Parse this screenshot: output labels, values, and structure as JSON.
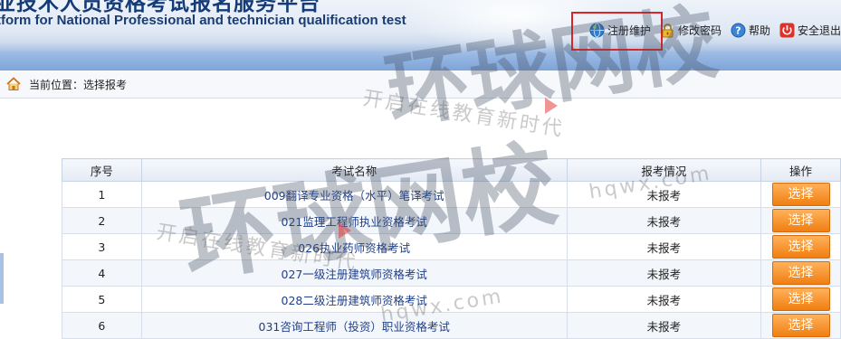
{
  "header": {
    "title_cn": "业技术人员资格考试报名服务平台",
    "title_en": "tform for National Professional and technician qualification test",
    "links": [
      {
        "label": "注册维护",
        "icon": "globe-icon"
      },
      {
        "label": "修改密码",
        "icon": "lock-icon"
      },
      {
        "label": "帮助",
        "icon": "help-icon"
      },
      {
        "label": "安全退出",
        "icon": "power-icon"
      }
    ]
  },
  "breadcrumb": {
    "text": "当前位置：选择报考",
    "icon": "home-icon"
  },
  "table": {
    "headers": [
      "序号",
      "考试名称",
      "报考情况",
      "操作"
    ],
    "rows": [
      {
        "no": "1",
        "name": "009翻译专业资格（水平）笔译考试",
        "status": "未报考",
        "action": "选择"
      },
      {
        "no": "2",
        "name": "021监理工程师执业资格考试",
        "status": "未报考",
        "action": "选择"
      },
      {
        "no": "3",
        "name": "026执业药师资格考试",
        "status": "未报考",
        "action": "选择"
      },
      {
        "no": "4",
        "name": "027一级注册建筑师资格考试",
        "status": "未报考",
        "action": "选择"
      },
      {
        "no": "5",
        "name": "028二级注册建筑师资格考试",
        "status": "未报考",
        "action": "选择"
      },
      {
        "no": "6",
        "name": "031咨询工程师（投资）职业资格考试",
        "status": "未报考",
        "action": "选择"
      }
    ]
  },
  "watermark": {
    "brand": "环球网校",
    "slogan": "开启在线教育新时代",
    "url": "hqwx.com"
  },
  "colors": {
    "accent_orange": "#f07f12",
    "header_blue": "#8fb1dd",
    "highlight_red": "#e02424",
    "link_blue": "#1e3f8a"
  }
}
